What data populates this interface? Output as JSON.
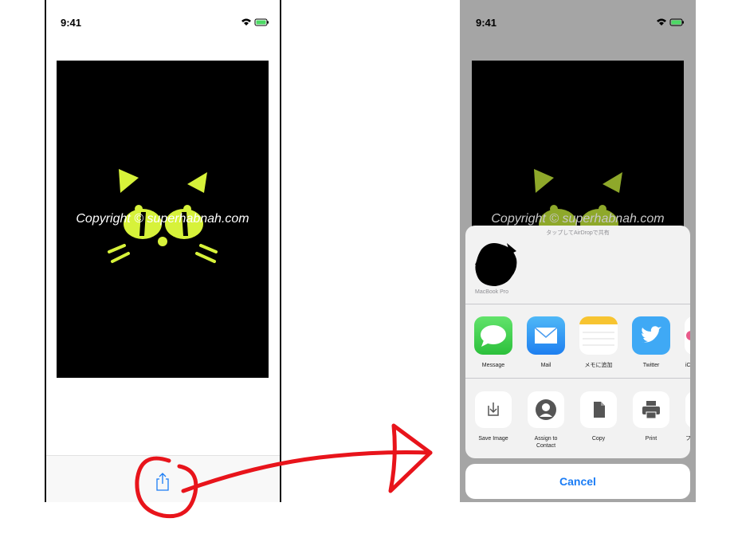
{
  "left_screen": {
    "status_time": "9:41",
    "watermark": "Copyright © superhabnah.com"
  },
  "right_screen": {
    "status_time": "9:41",
    "watermark": "Copyright © superhabnah.com",
    "share_sheet": {
      "airdrop_hint": "タップしてAirDropで共有",
      "airdrop_device": "MacBook Pro",
      "apps": [
        {
          "label": "Message",
          "icon": "message-icon"
        },
        {
          "label": "Mail",
          "icon": "mail-icon"
        },
        {
          "label": "メモに追加",
          "icon": "notes-icon"
        },
        {
          "label": "Twitter",
          "icon": "twitter-icon"
        },
        {
          "label": "iC",
          "icon": "icloud-icon"
        }
      ],
      "actions": [
        {
          "label": "Save Image",
          "icon": "save-image-icon"
        },
        {
          "label": "Assign to Contact",
          "icon": "contact-icon"
        },
        {
          "label": "Copy",
          "icon": "copy-icon"
        },
        {
          "label": "Print",
          "icon": "print-icon"
        },
        {
          "label": "フ",
          "icon": "more-icon"
        }
      ],
      "cancel_label": "Cancel"
    }
  },
  "colors": {
    "annotation_red": "#e8141b",
    "accent_blue": "#1a7cf5",
    "cat_yellow_green": "#d7f23a"
  }
}
